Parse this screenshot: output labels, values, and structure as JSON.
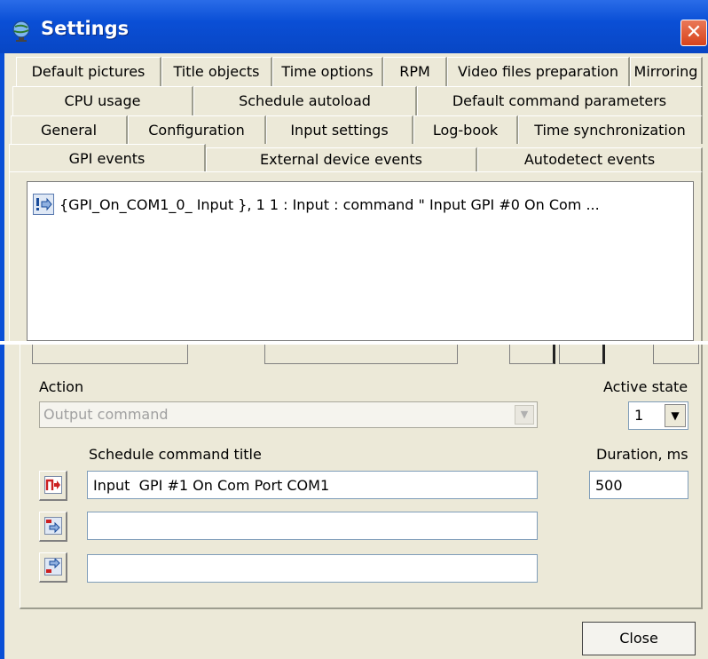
{
  "window": {
    "title": "Settings",
    "close_glyph": "✕",
    "title_icon": "app-globe-icon"
  },
  "tabs": {
    "row1": [
      "Default pictures",
      "Title objects",
      "Time options",
      "RPM",
      "Video files preparation",
      "Mirroring"
    ],
    "row2": [
      "CPU usage",
      "Schedule autoload",
      "Default command parameters"
    ],
    "row3": [
      "General",
      "Configuration",
      "Input settings",
      "Log-book",
      "Time synchronization"
    ],
    "row4": [
      "GPI events",
      "External device events",
      "Autodetect events"
    ],
    "selected": "GPI events"
  },
  "event_list": {
    "items": [
      "{GPI_On_COM1_0_ Input }, 1 1 :  Input : command \" Input   GPI #0 On Com ..."
    ]
  },
  "form": {
    "action_label": "Action",
    "action_value": "Output command",
    "active_state_label": "Active state",
    "active_state_value": "1",
    "schedule_title_label": "Schedule command title",
    "duration_label": "Duration, ms",
    "title_1": "Input  GPI #1 On Com Port COM1",
    "title_2": "",
    "title_3": "",
    "duration_value": "500"
  },
  "buttons": {
    "close_label": "Close"
  },
  "colors": {
    "titlebar": "#0a4fd6",
    "dialog_bg": "#ece9d8",
    "close_red": "#d8431c",
    "icon_red": "#cc2020"
  }
}
